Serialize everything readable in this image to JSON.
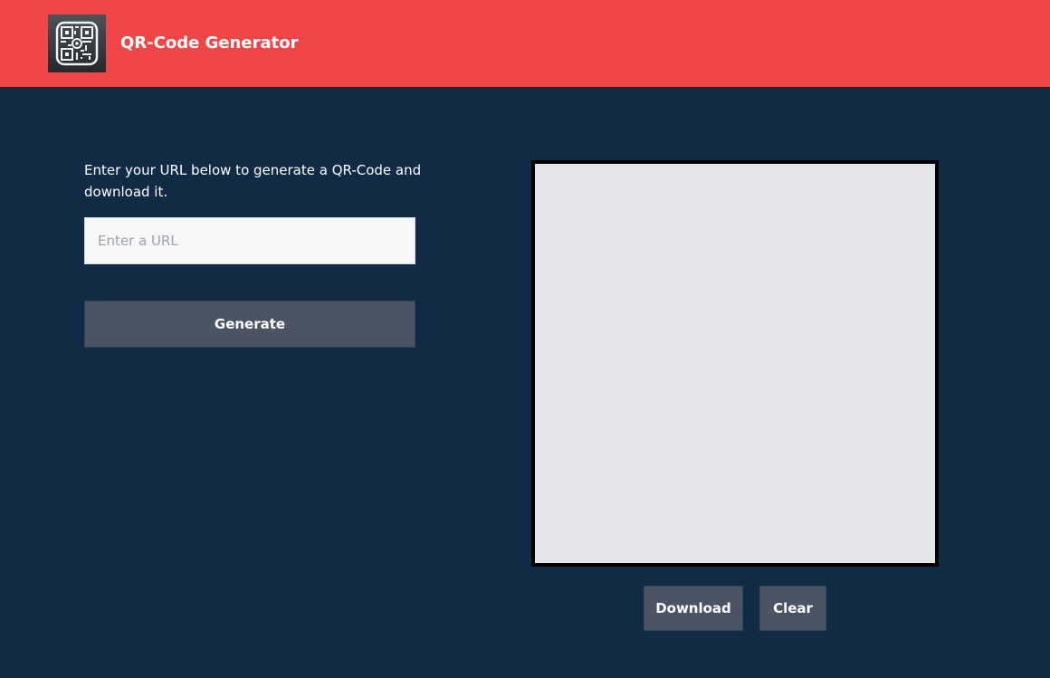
{
  "header": {
    "title": "QR-Code Generator",
    "logo_icon": "qr-code-icon",
    "background_color": "#f14647"
  },
  "form": {
    "instructions": "Enter your URL below to generate a QR-Code and download it.",
    "url_placeholder": "Enter a URL",
    "url_value": "",
    "generate_label": "Generate"
  },
  "preview": {
    "download_label": "Download",
    "clear_label": "Clear"
  },
  "colors": {
    "page_background": "#112a46",
    "button_background": "#4a5463",
    "preview_background": "#e5e6ea"
  }
}
